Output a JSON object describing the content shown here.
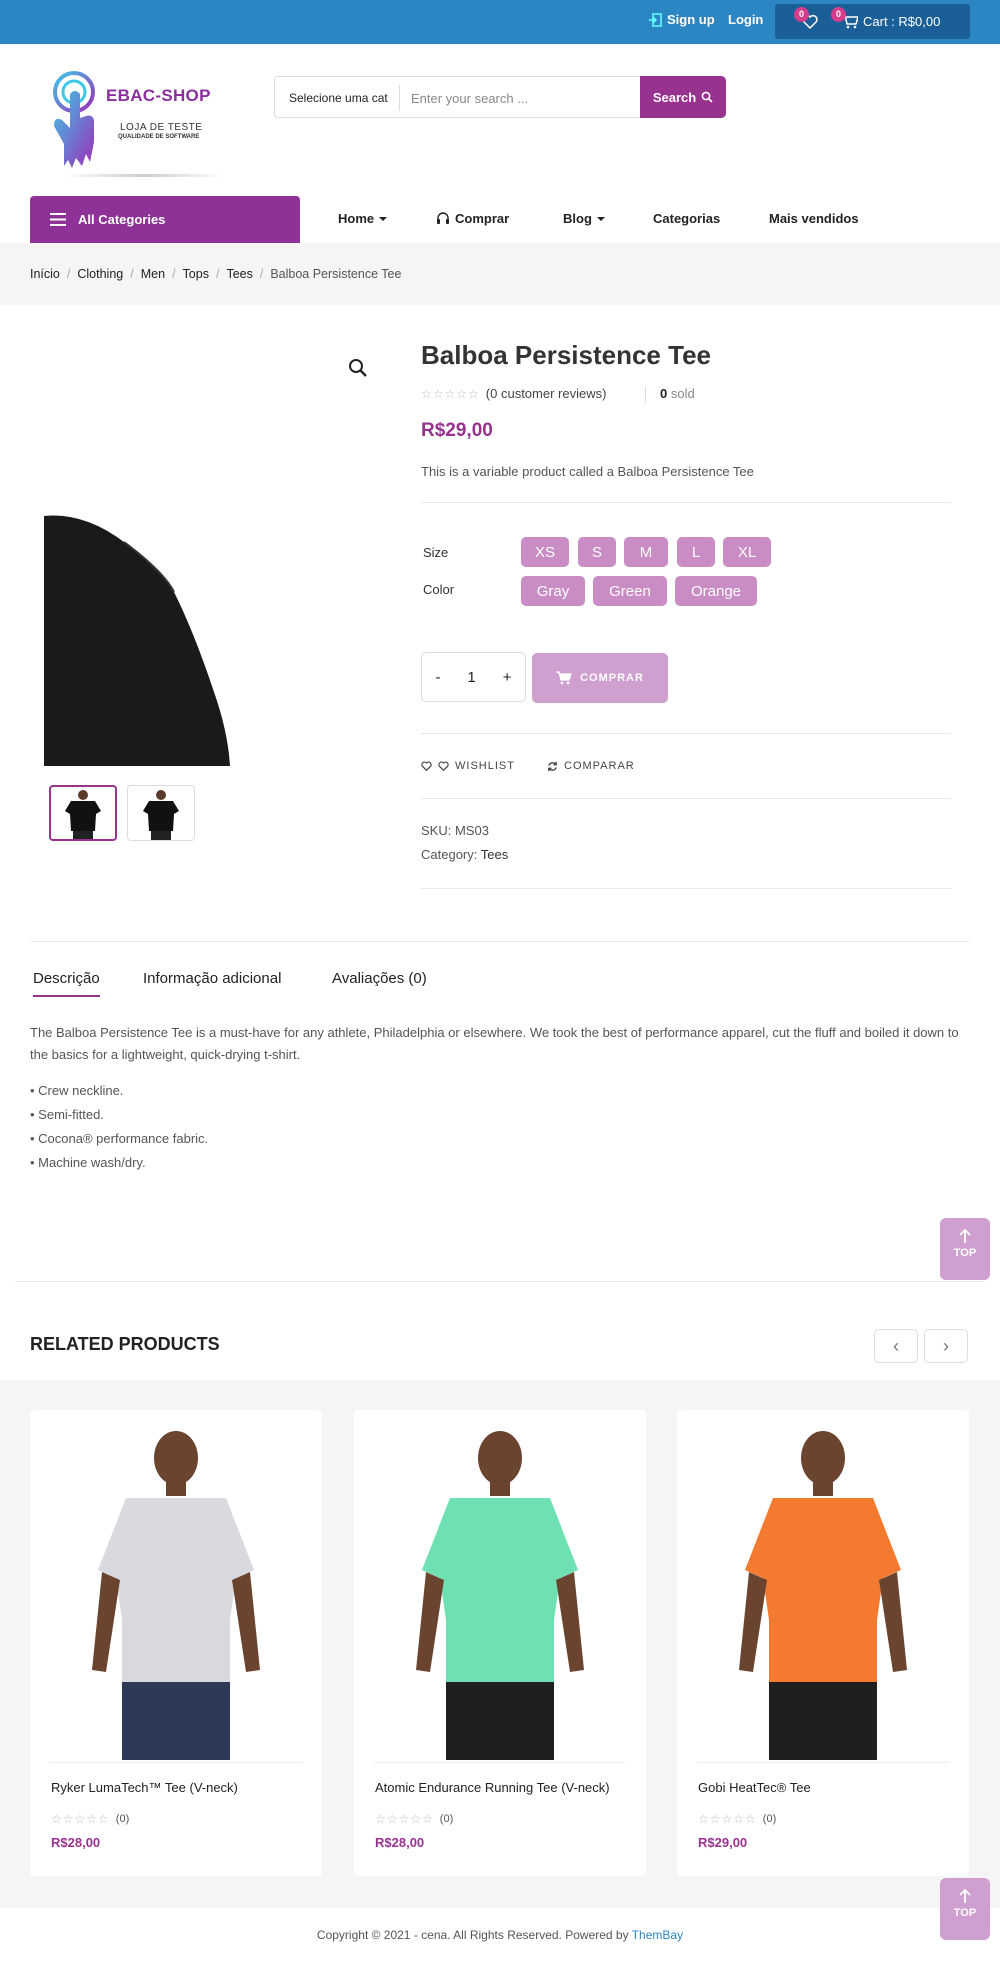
{
  "topbar": {
    "signup": "Sign up",
    "login": "Login",
    "wishlist_count": "0",
    "cart_count": "0",
    "cart_label": "Cart : R$0,00"
  },
  "header": {
    "brand": "EBAC-SHOP",
    "tagline1": "LOJA DE TESTE",
    "tagline2": "QUALIDADE DE SOFTWARE",
    "search_category": "Selecione uma cat",
    "search_placeholder": "Enter your search ...",
    "search_button": "Search"
  },
  "nav": {
    "all_categories": "All Categories",
    "items": [
      "Home",
      "Comprar",
      "Blog",
      "Categorias",
      "Mais vendidos"
    ]
  },
  "breadcrumb": [
    "Início",
    "Clothing",
    "Men",
    "Tops",
    "Tees",
    "Balboa Persistence Tee"
  ],
  "product": {
    "title": "Balboa Persistence Tee",
    "reviews": "(0 customer reviews)",
    "sold_count": "0",
    "sold_label": "sold",
    "price": "R$29,00",
    "short_description": "This is a variable product called a Balboa Persistence Tee",
    "size_label": "Size",
    "sizes": [
      "XS",
      "S",
      "M",
      "L",
      "XL"
    ],
    "color_label": "Color",
    "colors": [
      "Gray",
      "Green",
      "Orange"
    ],
    "quantity": "1",
    "qty_minus": "-",
    "qty_plus": "+",
    "buy_button": "COMPRAR",
    "wishlist": "WISHLIST",
    "compare": "COMPARAR",
    "sku_label": "SKU:",
    "sku": "MS03",
    "category_label": "Category:",
    "category": "Tees"
  },
  "tabs": {
    "items": [
      "Descrição",
      "Informação adicional",
      "Avaliações (0)"
    ],
    "description": "The Balboa Persistence Tee is a must-have for any athlete, Philadelphia or elsewhere. We took the best of performance apparel, cut the fluff and boiled it down to the basics for a lightweight, quick-drying t-shirt.",
    "bullets": [
      "• Crew neckline.",
      "• Semi-fitted.",
      "• Cocona® performance fabric.",
      "• Machine wash/dry."
    ]
  },
  "top_button": "TOP",
  "related": {
    "title": "RELATED PRODUCTS",
    "products": [
      {
        "name": "Ryker LumaTech™ Tee (V-neck)",
        "reviews": "(0)",
        "price": "R$28,00",
        "shirt_color": "#d9dadf",
        "pants_color": "#2e3a55"
      },
      {
        "name": "Atomic Endurance Running Tee (V-neck)",
        "reviews": "(0)",
        "price": "R$28,00",
        "shirt_color": "#6fe0b2",
        "pants_color": "#1f1f1f"
      },
      {
        "name": "Gobi HeatTec® Tee",
        "reviews": "(0)",
        "price": "R$29,00",
        "shirt_color": "#f37a2e",
        "pants_color": "#1f1f1f"
      }
    ]
  },
  "footer": {
    "text": "Copyright © 2021 - cena. All Rights Reserved. Powered by",
    "link": "ThemBay"
  }
}
